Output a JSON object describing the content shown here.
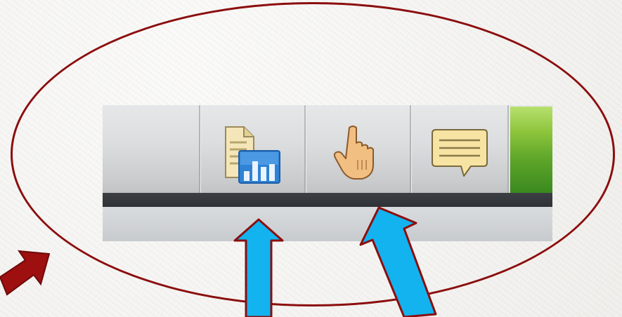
{
  "annotation": {
    "ellipse_color": "#8b0e0e",
    "pointer_arrow_color": "#8b0e0e",
    "callout_arrow_fill": "#12b3ef",
    "callout_arrow_stroke": "#8b0e0e"
  },
  "toolbar": {
    "buttons": [
      {
        "name": "report-chart",
        "icon": "document-chart-icon"
      },
      {
        "name": "hand-pointer",
        "icon": "hand-pointer-icon"
      },
      {
        "name": "comment",
        "icon": "speech-bubble-icon"
      },
      {
        "name": "green-action",
        "icon": "green-button"
      }
    ],
    "colors": {
      "strip_top": "#e5e7e8",
      "strip_bottom": "#bfc1c3",
      "shadow_band": "#35383c",
      "green_accent": "#5fa62a"
    }
  }
}
